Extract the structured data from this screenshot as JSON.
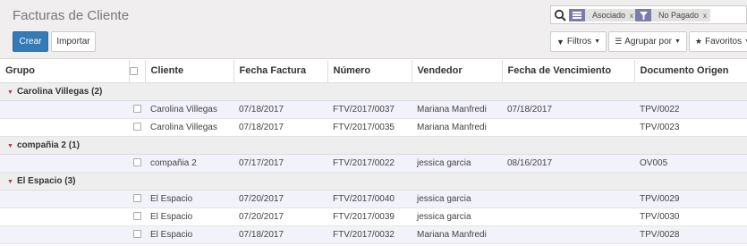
{
  "header": {
    "title": "Facturas de Cliente",
    "facets": [
      {
        "icon": "list-icon",
        "label": "Asociado",
        "close": "x"
      },
      {
        "icon": "filter-icon",
        "label": "No Pagado",
        "close": "x"
      }
    ]
  },
  "buttons": {
    "create": "Crear",
    "import": "Importar",
    "filters": "Filtros",
    "group_by": "Agrupar por",
    "favorites": "Favoritos"
  },
  "table": {
    "columns": [
      "Grupo",
      "Cliente",
      "Fecha Factura",
      "Número",
      "Vendedor",
      "Fecha de Vencimiento",
      "Documento Origen"
    ],
    "groups": [
      {
        "label": "Carolina Villegas (2)",
        "rows": [
          {
            "cliente": "Carolina Villegas",
            "fecha": "07/18/2017",
            "numero": "FTV/2017/0037",
            "vendedor": "Mariana Manfredi",
            "vencimiento": "07/18/2017",
            "origen": "TPV/0022"
          },
          {
            "cliente": "Carolina Villegas",
            "fecha": "07/18/2017",
            "numero": "FTV/2017/0035",
            "vendedor": "Mariana Manfredi",
            "vencimiento": "",
            "origen": "TPV/0023"
          }
        ]
      },
      {
        "label": "compañia 2 (1)",
        "rows": [
          {
            "cliente": "compañia 2",
            "fecha": "07/17/2017",
            "numero": "FTV/2017/0022",
            "vendedor": "jessica garcia",
            "vencimiento": "08/16/2017",
            "origen": "OV005"
          }
        ]
      },
      {
        "label": "El Espacio (3)",
        "rows": [
          {
            "cliente": "El Espacio",
            "fecha": "07/20/2017",
            "numero": "FTV/2017/0040",
            "vendedor": "jessica garcia",
            "vencimiento": "",
            "origen": "TPV/0029"
          },
          {
            "cliente": "El Espacio",
            "fecha": "07/20/2017",
            "numero": "FTV/2017/0039",
            "vendedor": "jessica garcia",
            "vencimiento": "",
            "origen": "TPV/0030"
          },
          {
            "cliente": "El Espacio",
            "fecha": "07/18/2017",
            "numero": "FTV/2017/0032",
            "vendedor": "Mariana Manfredi",
            "vencimiento": "",
            "origen": "TPV/0028"
          }
        ]
      }
    ]
  }
}
